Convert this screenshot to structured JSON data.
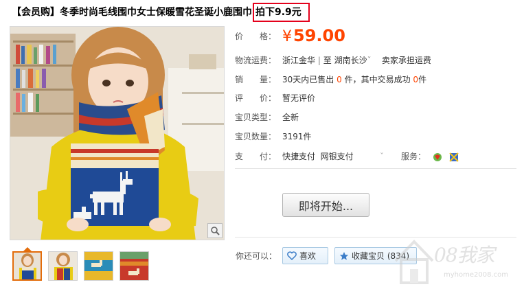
{
  "title": {
    "text": "【会员购】冬季时尚毛线围巾女士保暖雪花圣诞小鹿围巾",
    "highlight": "拍下9.9元",
    "highlight_color": "#e4001b"
  },
  "price": {
    "label": "价　　格：",
    "currency": "¥",
    "amount": "59.00",
    "color": "#ff4400"
  },
  "shipping": {
    "label": "物流运费：",
    "from": "浙江金华",
    "sep": "|",
    "to_prefix": "至",
    "to": "湖南长沙",
    "arrow": "ˇ",
    "note": "卖家承担运费"
  },
  "sales": {
    "label": "销　　量：",
    "prefix": "30天内已售出",
    "sold": "0",
    "mid": "件，其中交易成功",
    "success": "0",
    "suffix": "件"
  },
  "rating": {
    "label": "评　　价：",
    "value": "暂无评价"
  },
  "condition": {
    "label": "宝贝类型：",
    "value": "全新"
  },
  "stock": {
    "label": "宝贝数量：",
    "value": "3191件"
  },
  "payment": {
    "label": "支　　付：",
    "methods": [
      "快捷支付",
      "网银支付"
    ],
    "services_label": "服务："
  },
  "start_button": {
    "label": "即将开始..."
  },
  "actions": {
    "label": "你还可以：",
    "like": "喜欢",
    "favorite": "收藏宝贝 (834)"
  },
  "watermark": {
    "text": "08我家",
    "url": "myhome2008.com"
  },
  "icons": {
    "zoom": "magnifier-icon",
    "like": "heart-icon",
    "favorite": "star-icon",
    "service1": "service-badge-icon",
    "service2": "service-shield-icon"
  }
}
